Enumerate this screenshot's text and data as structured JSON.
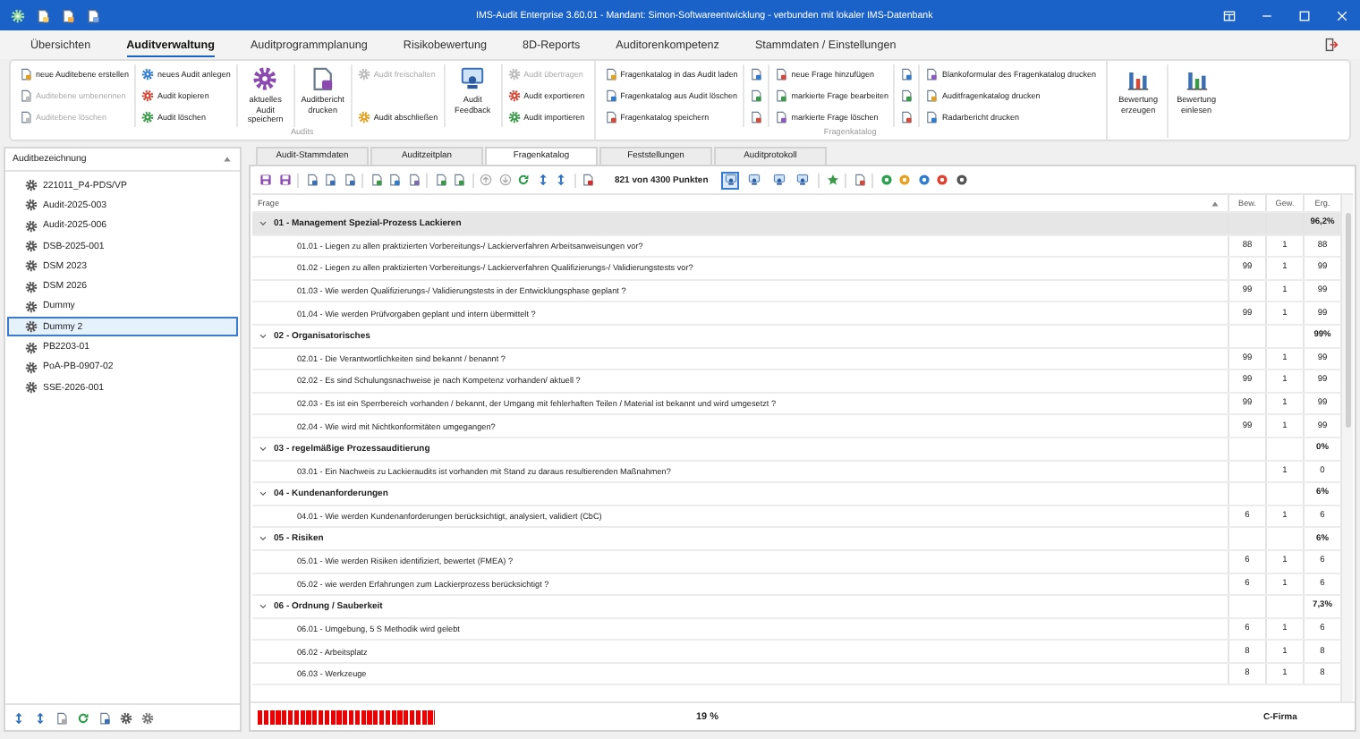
{
  "window": {
    "title": "IMS-Audit Enterprise 3.60.01 - Mandant: Simon-Softwareentwicklung - verbunden mit lokaler IMS-Datenbank"
  },
  "menu_tabs": [
    {
      "label": "Übersichten",
      "selected": false
    },
    {
      "label": "Auditverwaltung",
      "selected": true
    },
    {
      "label": "Auditprogrammplanung",
      "selected": false
    },
    {
      "label": "Risikobewertung",
      "selected": false
    },
    {
      "label": "8D-Reports",
      "selected": false
    },
    {
      "label": "Auditorenkompetenz",
      "selected": false
    },
    {
      "label": "Stammdaten / Einstellungen",
      "selected": false
    }
  ],
  "ribbon": {
    "groups": [
      {
        "label": "Audits",
        "columns": [
          {
            "kind": "small",
            "items": [
              {
                "label": "neue Auditebene erstellen",
                "disabled": false
              },
              {
                "label": "Auditebene umbenennen",
                "disabled": true
              },
              {
                "label": "Auditebene löschen",
                "disabled": true
              }
            ]
          },
          {
            "kind": "small",
            "items": [
              {
                "label": "neues Audit anlegen",
                "disabled": false
              },
              {
                "label": "Audit kopieren",
                "disabled": false
              },
              {
                "label": "Audit löschen",
                "disabled": false
              }
            ]
          },
          {
            "kind": "large",
            "label": "aktuelles Audit speichern"
          },
          {
            "kind": "large",
            "label": "Auditbericht drucken"
          },
          {
            "kind": "small",
            "items": [
              {
                "label": "Audit freischalten",
                "disabled": true
              },
              {
                "label": "Audit abschließen",
                "disabled": false
              }
            ]
          },
          {
            "kind": "large",
            "label": "Audit Feedback"
          },
          {
            "kind": "small",
            "items": [
              {
                "label": "Audit übertragen",
                "disabled": true
              },
              {
                "label": "Audit exportieren",
                "disabled": false
              },
              {
                "label": "Audit importieren",
                "disabled": false
              }
            ]
          }
        ]
      },
      {
        "label": "Fragenkatalog",
        "columns": [
          {
            "kind": "small",
            "items": [
              {
                "label": "Fragenkatalog in das Audit laden",
                "disabled": false
              },
              {
                "label": "Fragenkatalog aus Audit löschen",
                "disabled": false
              },
              {
                "label": "Fragenkatalog speichern",
                "disabled": false
              }
            ]
          },
          {
            "kind": "icons"
          },
          {
            "kind": "small",
            "items": [
              {
                "label": "neue Frage hinzufügen",
                "disabled": false
              },
              {
                "label": "markierte Frage bearbeiten",
                "disabled": false
              },
              {
                "label": "markierte Frage löschen",
                "disabled": false
              }
            ]
          },
          {
            "kind": "icons"
          },
          {
            "kind": "small",
            "items": [
              {
                "label": "Blankoformular des Fragenkatalog drucken",
                "disabled": false
              },
              {
                "label": "Auditfragenkatalog drucken",
                "disabled": false
              },
              {
                "label": "Radarbericht drucken",
                "disabled": false
              }
            ]
          }
        ]
      },
      {
        "columns": [
          {
            "kind": "large",
            "label": "Bewertung erzeugen"
          },
          {
            "kind": "large",
            "label": "Bewertung einlesen"
          }
        ]
      }
    ]
  },
  "audit_list": {
    "header": "Auditbezeichnung",
    "items": [
      {
        "label": "221011_P4-PDS/VP",
        "selected": false
      },
      {
        "label": "Audit-2025-003",
        "selected": false
      },
      {
        "label": "Audit-2025-006",
        "selected": false
      },
      {
        "label": "DSB-2025-001",
        "selected": false
      },
      {
        "label": "DSM 2023",
        "selected": false
      },
      {
        "label": "DSM 2026",
        "selected": false
      },
      {
        "label": "Dummy",
        "selected": false
      },
      {
        "label": "Dummy 2",
        "selected": true
      },
      {
        "label": "PB2203-01",
        "selected": false
      },
      {
        "label": "PoA-PB-0907-02",
        "selected": false
      },
      {
        "label": "SSE-2026-001",
        "selected": false
      }
    ]
  },
  "detail_tabs": [
    {
      "label": "Audit-Stammdaten",
      "selected": false
    },
    {
      "label": "Auditzeitplan",
      "selected": false
    },
    {
      "label": "Fragenkatalog",
      "selected": true
    },
    {
      "label": "Feststellungen",
      "selected": false
    },
    {
      "label": "Auditprotokoll",
      "selected": false
    }
  ],
  "toolbar": {
    "points": "821 von 4300 Punkten",
    "view_buttons": [
      {
        "selected": true
      },
      {
        "selected": false
      },
      {
        "selected": false
      },
      {
        "selected": false
      }
    ]
  },
  "table": {
    "columns": [
      "Frage",
      "Bew.",
      "Gew.",
      "Erg."
    ],
    "groups": [
      {
        "title": "01 - Management Spezial-Prozess Lackieren",
        "result": "96,2%",
        "expanded": true,
        "selected": true,
        "rows": [
          {
            "question": "01.01 - Liegen zu allen praktizierten Vorbereitungs-/ Lackierverfahren Arbeitsanweisungen vor?",
            "bew": "88",
            "gew": "1",
            "erg": "88"
          },
          {
            "question": "01.02 - Liegen zu allen praktizierten Vorbereitungs-/ Lackierverfahren Qualifizierungs-/ Validierungstests vor?",
            "bew": "99",
            "gew": "1",
            "erg": "99"
          },
          {
            "question": "01.03 - Wie werden Qualifizierungs-/ Validierungstests in der Entwicklungsphase geplant ?",
            "bew": "99",
            "gew": "1",
            "erg": "99"
          },
          {
            "question": "01.04 - Wie werden Prüfvorgaben geplant und intern übermittelt ?",
            "bew": "99",
            "gew": "1",
            "erg": "99"
          }
        ]
      },
      {
        "title": "02 - Organisatorisches",
        "result": "99%",
        "expanded": true,
        "selected": false,
        "rows": [
          {
            "question": "02.01 - Die Verantwortlichkeiten sind bekannt / benannt ?",
            "bew": "99",
            "gew": "1",
            "erg": "99"
          },
          {
            "question": "02.02 - Es sind Schulungsnachweise je nach Kompetenz vorhanden/ aktuell ?",
            "bew": "99",
            "gew": "1",
            "erg": "99"
          },
          {
            "question": "02.03 - Es ist ein Sperrbereich vorhanden / bekannt, der Umgang mit fehlerhaften Teilen / Material ist bekannt und wird umgesetzt ?",
            "bew": "99",
            "gew": "1",
            "erg": "99"
          },
          {
            "question": "02.04 - Wie wird mit Nichtkonformitäten umgegangen?",
            "bew": "99",
            "gew": "1",
            "erg": "99"
          }
        ]
      },
      {
        "title": "03 - regelmäßige Prozessauditierung",
        "result": "0%",
        "expanded": true,
        "selected": false,
        "rows": [
          {
            "question": "03.01 - Ein Nachweis zu Lackieraudits  ist vorhanden mit Stand zu daraus resultierenden Maßnahmen?",
            "gew": "1",
            "erg": "0"
          }
        ]
      },
      {
        "title": "04 - Kundenanforderungen",
        "result": "6%",
        "expanded": true,
        "selected": false,
        "rows": [
          {
            "question": "04.01 - Wie werden Kundenanforderungen berücksichtigt, analysiert, validiert (CbC)",
            "bew": "6",
            "gew": "1",
            "erg": "6"
          }
        ]
      },
      {
        "title": "05 - Risiken",
        "result": "6%",
        "expanded": true,
        "selected": false,
        "rows": [
          {
            "question": "05.01 - Wie werden Risiken identifiziert, bewertet (FMEA) ?",
            "bew": "6",
            "gew": "1",
            "erg": "6"
          },
          {
            "question": "05.02 - wie werden Erfahrungen zum Lackierprozess berücksichtigt ?",
            "bew": "6",
            "gew": "1",
            "erg": "6"
          }
        ]
      },
      {
        "title": "06 - Ordnung / Sauberkeit",
        "result": "7,3%",
        "expanded": true,
        "selected": false,
        "rows": [
          {
            "question": "06.01 - Umgebung, 5 S Methodik wird gelebt",
            "bew": "6",
            "gew": "1",
            "erg": "6"
          },
          {
            "question": "06.02 - Arbeitsplatz",
            "bew": "8",
            "gew": "1",
            "erg": "8"
          },
          {
            "question": "06.03 - Werkzeuge",
            "bew": "8",
            "gew": "1",
            "erg": "8"
          }
        ]
      }
    ]
  },
  "status": {
    "level": 0.19,
    "percent": "19 %",
    "company": "C-Firma"
  }
}
